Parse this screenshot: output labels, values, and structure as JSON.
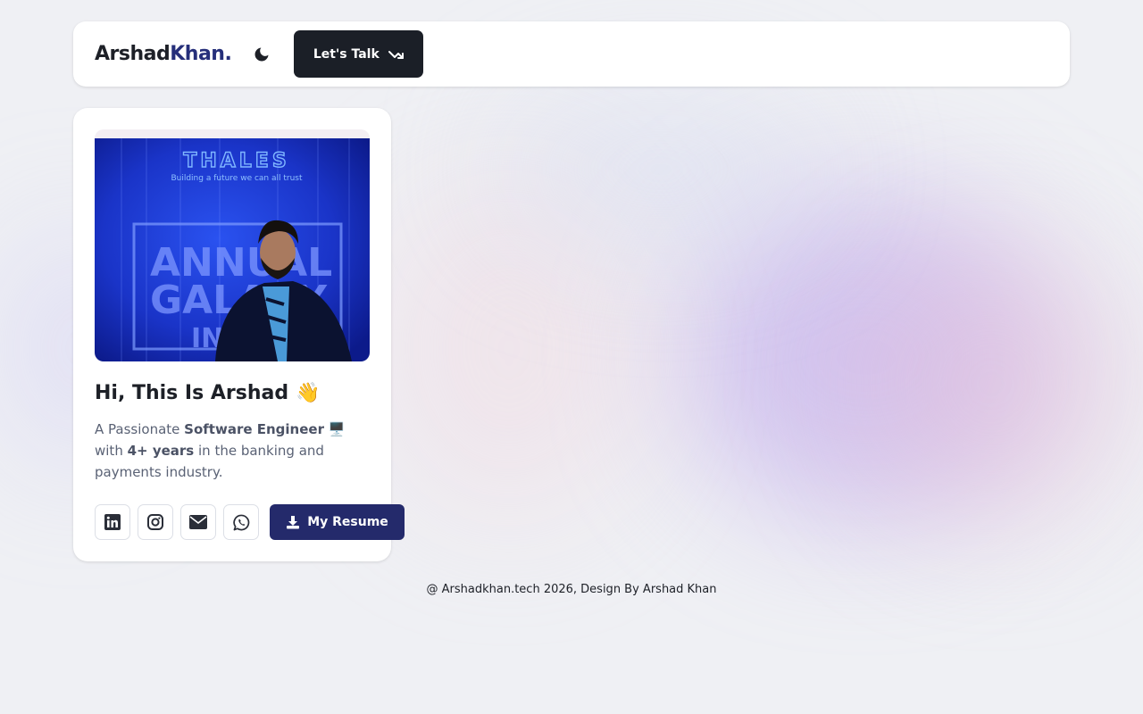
{
  "header": {
    "logo_primary": "Arshad",
    "logo_accent": "Khan.",
    "theme_icon": "moon-icon",
    "cta_label": "Let's Talk",
    "cta_icon": "trending-arrow-icon"
  },
  "profile": {
    "photo": {
      "banner_brand": "THALES",
      "banner_tagline": "Building a future we can all trust",
      "banner_event_line1": "ANNUAL",
      "banner_event_line2": "GALAXY",
      "banner_event_line3": "IN"
    },
    "greeting": "Hi, This Is Arshad",
    "greeting_emoji": "👋",
    "bio_prefix": "A Passionate ",
    "bio_role": "Software Engineer",
    "bio_emoji": "🖥️",
    "bio_middle": " with ",
    "bio_experience": "4+ years",
    "bio_suffix": " in the banking and payments industry.",
    "socials": [
      {
        "name": "linkedin",
        "icon": "linkedin-icon"
      },
      {
        "name": "instagram",
        "icon": "instagram-icon"
      },
      {
        "name": "email",
        "icon": "envelope-icon"
      },
      {
        "name": "whatsapp",
        "icon": "whatsapp-icon"
      }
    ],
    "resume_label": "My Resume",
    "resume_icon": "download-icon"
  },
  "footer": {
    "text": "@ Arshadkhan.tech 2026, Design By Arshad Khan"
  },
  "colors": {
    "accent": "#262f7a",
    "dark_button": "#1b1f27",
    "resume_button": "#242a6b",
    "background": "#eff0f4"
  }
}
